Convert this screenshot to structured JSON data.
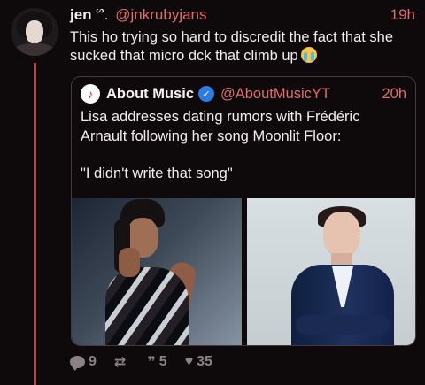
{
  "post": {
    "author": {
      "display_name": "jen",
      "name_emoji": "ᔥ.",
      "handle": "@jnkrubyjans",
      "time": "19h",
      "avatar_icon": "profile-photo"
    },
    "text": "This ho trying so hard to discredit the fact that she sucked that micro dck that climb up",
    "text_emoji": "crying-face-icon"
  },
  "quote": {
    "author": {
      "display_name": "About Music",
      "handle": "@AboutMusicYT",
      "time": "20h",
      "avatar_icon": "music-note-icon",
      "verified_icon": "verified-badge-icon",
      "verified_mark": "✓",
      "avatar_glyph": "♪"
    },
    "text_line_1": "Lisa addresses dating rumors with Frédéric Arnault following her song Moonlit Floor:",
    "text_line_2": "\"I didn't write that song\"",
    "media": [
      {
        "icon": "photo-woman"
      },
      {
        "icon": "photo-man"
      }
    ]
  },
  "actions": {
    "replies": "9",
    "reposts": "",
    "quotes": "5",
    "likes": "35",
    "repost_icon": "repost-icon",
    "quote_icon": "quote-icon",
    "like_icon": "heart-icon",
    "repost_glyph": "⇄",
    "quote_glyph": "❞",
    "like_glyph": "♥"
  },
  "colors": {
    "background": "#0e0a0b",
    "accent": "#e06b71",
    "thread_line": "#b3474b",
    "muted": "#8b8286",
    "verified": "#2e7ce3"
  }
}
